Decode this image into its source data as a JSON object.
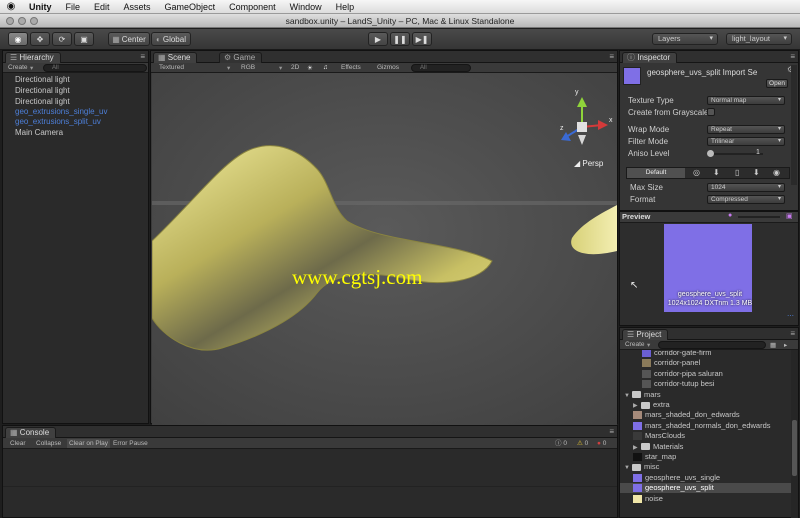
{
  "menubar": {
    "apple": "",
    "items": [
      "Unity",
      "File",
      "Edit",
      "Assets",
      "GameObject",
      "Component",
      "Window",
      "Help"
    ]
  },
  "window": {
    "title": "sandbox.unity – LandS_Unity – PC, Mac & Linux Standalone"
  },
  "toolbar": {
    "center_label": "Center",
    "global_label": "Global",
    "layers_label": "Layers",
    "layout_label": "light_layout"
  },
  "hierarchy": {
    "tab": "Hierarchy",
    "create": "Create",
    "search_placeholder": "All",
    "items": [
      {
        "label": "Directional light",
        "color": "#c8c8c8"
      },
      {
        "label": "Directional light",
        "color": "#c8c8c8"
      },
      {
        "label": "Directional light",
        "color": "#c8c8c8"
      },
      {
        "label": "geo_extrusions_single_uv",
        "color": "#4d7fd8"
      },
      {
        "label": "geo_extrusions_split_uv",
        "color": "#4d7fd8"
      },
      {
        "label": "Main Camera",
        "color": "#c8c8c8"
      }
    ]
  },
  "scene": {
    "tabs": [
      "Scene",
      "Game"
    ],
    "render_mode": "Textured",
    "color_mode": "RGB",
    "mode_2d": "2D",
    "effects": "Effects",
    "gizmos": "Gizmos",
    "search_placeholder": "All",
    "persp_label": "Persp",
    "watermark": "www.cgtsj.com",
    "axes": {
      "y": "y",
      "x": "x",
      "z": "z"
    }
  },
  "inspector": {
    "tab": "Inspector",
    "asset_title": "geosphere_uvs_split Import Se",
    "open_button": "Open",
    "rows": [
      {
        "label": "Texture Type",
        "value": "Normal map"
      },
      {
        "label": "Create from Grayscale",
        "value": ""
      },
      {
        "label": "Wrap Mode",
        "value": "Repeat"
      },
      {
        "label": "Filter Mode",
        "value": "Trilinear"
      },
      {
        "label": "Aniso Level",
        "value": "1"
      }
    ],
    "platform_default": "Default",
    "max_size_label": "Max Size",
    "max_size_value": "1024",
    "format_label": "Format",
    "format_value": "Compressed"
  },
  "preview": {
    "title": "Preview",
    "name": "geosphere_uvs_split",
    "info": "1024x1024  DXTnm   1.3 MB"
  },
  "project": {
    "tab": "Project",
    "create": "Create",
    "items": [
      {
        "label": "corridor-gate-firm",
        "indent": 2,
        "kind": "thumb",
        "color": "#6b5fd1"
      },
      {
        "label": "corridor-panel",
        "indent": 2,
        "kind": "thumb",
        "color": "#8a7a5a"
      },
      {
        "label": "corridor-pipa saluran",
        "indent": 2,
        "kind": "thumb",
        "color": "#555555"
      },
      {
        "label": "corridor-tutup besi",
        "indent": 2,
        "kind": "thumb",
        "color": "#555555"
      },
      {
        "label": "mars",
        "indent": 0,
        "kind": "folder-open"
      },
      {
        "label": "extra",
        "indent": 1,
        "kind": "folder-closed"
      },
      {
        "label": "mars_shaded_don_edwards",
        "indent": 1,
        "kind": "thumb",
        "color": "#a58a7a"
      },
      {
        "label": "mars_shaded_normals_don_edwards",
        "indent": 1,
        "kind": "thumb",
        "color": "#7f6fe6"
      },
      {
        "label": "MarsClouds",
        "indent": 1,
        "kind": "thumb",
        "color": "#3a3a3a"
      },
      {
        "label": "Materials",
        "indent": 1,
        "kind": "folder-closed"
      },
      {
        "label": "star_map",
        "indent": 1,
        "kind": "thumb",
        "color": "#111111"
      },
      {
        "label": "misc",
        "indent": 0,
        "kind": "folder-open"
      },
      {
        "label": "geosphere_uvs_single",
        "indent": 1,
        "kind": "thumb",
        "color": "#7f6fe6"
      },
      {
        "label": "geosphere_uvs_split",
        "indent": 1,
        "kind": "thumb",
        "color": "#7f6fe6",
        "selected": true
      },
      {
        "label": "noise",
        "indent": 1,
        "kind": "thumb",
        "color": "#f0e6a8"
      }
    ]
  },
  "console": {
    "tab": "Console",
    "buttons": [
      "Clear",
      "Collapse",
      "Clear on Play",
      "Error Pause"
    ],
    "count_info": "0",
    "count_warn": "0",
    "count_error": "0"
  }
}
